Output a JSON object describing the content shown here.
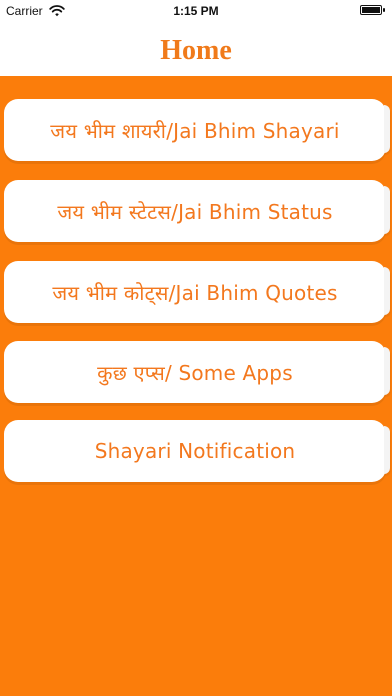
{
  "status_bar": {
    "carrier": "Carrier",
    "time": "1:15 PM",
    "battery_level": 1.0
  },
  "nav": {
    "title": "Home"
  },
  "menu": {
    "items": [
      {
        "label": "जय भीम शायरी/Jai Bhim Shayari"
      },
      {
        "label": "जय भीम स्टेटस/Jai Bhim Status"
      },
      {
        "label": "जय भीम कोट्स/Jai Bhim Quotes"
      },
      {
        "label": "कुछ एप्स/ Some Apps"
      },
      {
        "label": "Shayari Notification"
      }
    ]
  },
  "colors": {
    "accent": "#F07A1A",
    "background_orange": "#FB7D0B",
    "button_text": "#F3781E",
    "button_bg": "#FFFFFF"
  }
}
